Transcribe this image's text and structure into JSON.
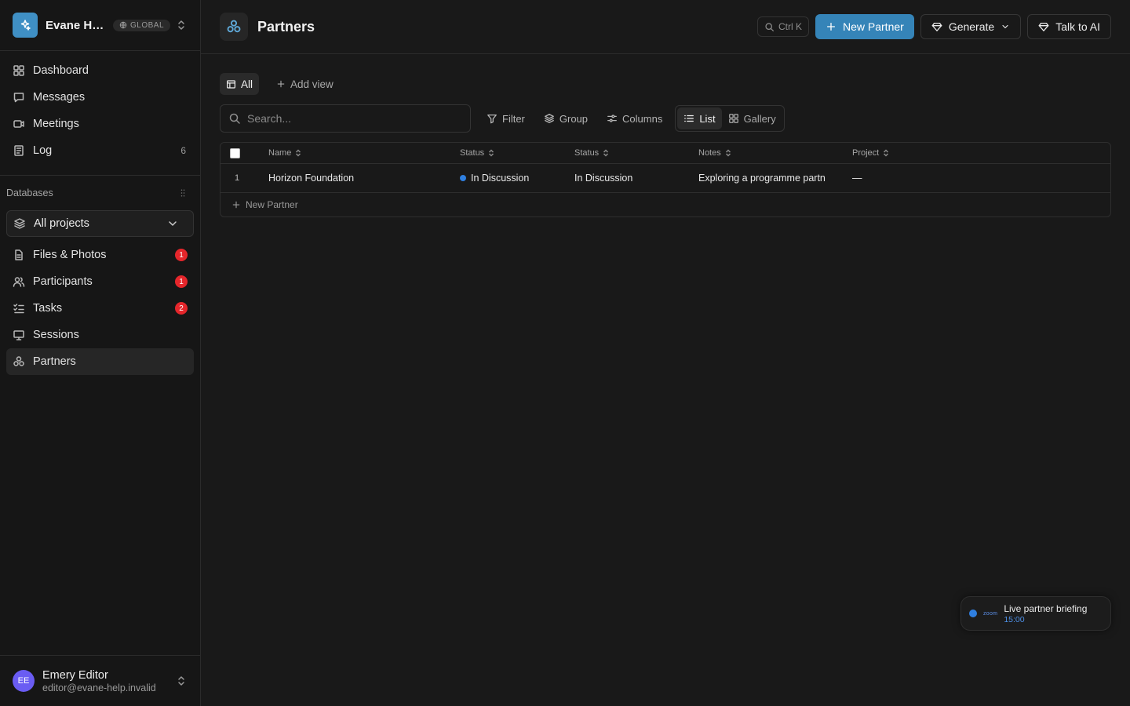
{
  "workspace": {
    "name": "Evane He...",
    "badge": "GLOBAL"
  },
  "nav": [
    {
      "label": "Dashboard",
      "icon": "grid-icon"
    },
    {
      "label": "Messages",
      "icon": "message-icon"
    },
    {
      "label": "Meetings",
      "icon": "video-icon"
    },
    {
      "label": "Log",
      "icon": "log-icon",
      "count": "6"
    }
  ],
  "databases": {
    "heading": "Databases",
    "project_select": "All projects",
    "items": [
      {
        "label": "Files & Photos",
        "badge": "1"
      },
      {
        "label": "Participants",
        "badge": "1"
      },
      {
        "label": "Tasks",
        "badge": "2"
      },
      {
        "label": "Sessions"
      },
      {
        "label": "Partners"
      }
    ]
  },
  "user": {
    "initials": "EE",
    "name": "Emery Editor",
    "email": "editor@evane-help.invalid"
  },
  "header": {
    "title": "Partners",
    "shortcut": "Ctrl K",
    "new_button": "New Partner",
    "generate": "Generate",
    "talk": "Talk to AI"
  },
  "views": {
    "active": "All",
    "add": "Add view"
  },
  "toolbar": {
    "search_placeholder": "Search...",
    "filter": "Filter",
    "group": "Group",
    "columns": "Columns",
    "list": "List",
    "gallery": "Gallery"
  },
  "table": {
    "headers": [
      "Name",
      "Status",
      "Status",
      "Notes",
      "Project"
    ],
    "rows": [
      {
        "num": "1",
        "name": "Horizon Foundation",
        "status": "In Discussion",
        "status2": "In Discussion",
        "notes": "Exploring a programme partn",
        "project": "—"
      }
    ],
    "new_row": "New Partner"
  },
  "toast": {
    "title": "Live partner briefing",
    "time": "15:00",
    "brand": "zoom"
  },
  "colors": {
    "accent": "#3584b8",
    "status_dot": "#2f7fe0",
    "badge_red": "#e5262b",
    "avatar": "#6a5cf3"
  }
}
